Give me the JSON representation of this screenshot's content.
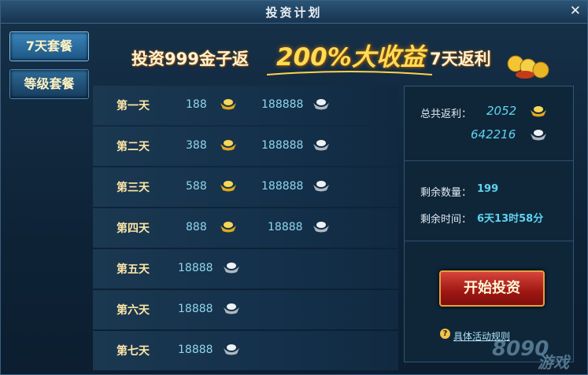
{
  "window": {
    "title": "投资计划"
  },
  "tabs": [
    {
      "label": "7天套餐",
      "active": true
    },
    {
      "label": "等级套餐",
      "active": false
    }
  ],
  "banner": {
    "part1": "投资999金子返",
    "highlight": "200%大收益",
    "part2": "7天返利"
  },
  "days": [
    {
      "day": "第一天",
      "gold": "188",
      "silver": "188888"
    },
    {
      "day": "第二天",
      "gold": "388",
      "silver": "188888"
    },
    {
      "day": "第三天",
      "gold": "588",
      "silver": "188888"
    },
    {
      "day": "第四天",
      "gold": "888",
      "silver": "18888"
    },
    {
      "day": "第五天",
      "silver": "18888"
    },
    {
      "day": "第六天",
      "silver": "18888"
    },
    {
      "day": "第七天",
      "silver": "18888"
    }
  ],
  "summary": {
    "total_label": "总共返利：",
    "total_gold": "2052",
    "total_silver": "642216",
    "remaining_count_label": "剩余数量：",
    "remaining_count": "199",
    "remaining_time_label": "剩余时间：",
    "remaining_time": "6天13时58分",
    "start_button": "开始投资",
    "rules_link": "具体活动规则"
  },
  "watermark": {
    "number": "8090",
    "suffix": "游戏"
  },
  "colors": {
    "gold": "#f3c532",
    "silver": "#dde3ea",
    "accent_cyan": "#5fd3f0",
    "button_red": "#b3221c"
  },
  "icons": [
    "close-icon",
    "gold-ingot-icon",
    "silver-ingot-icon",
    "question-icon",
    "coin-stack-icon"
  ]
}
